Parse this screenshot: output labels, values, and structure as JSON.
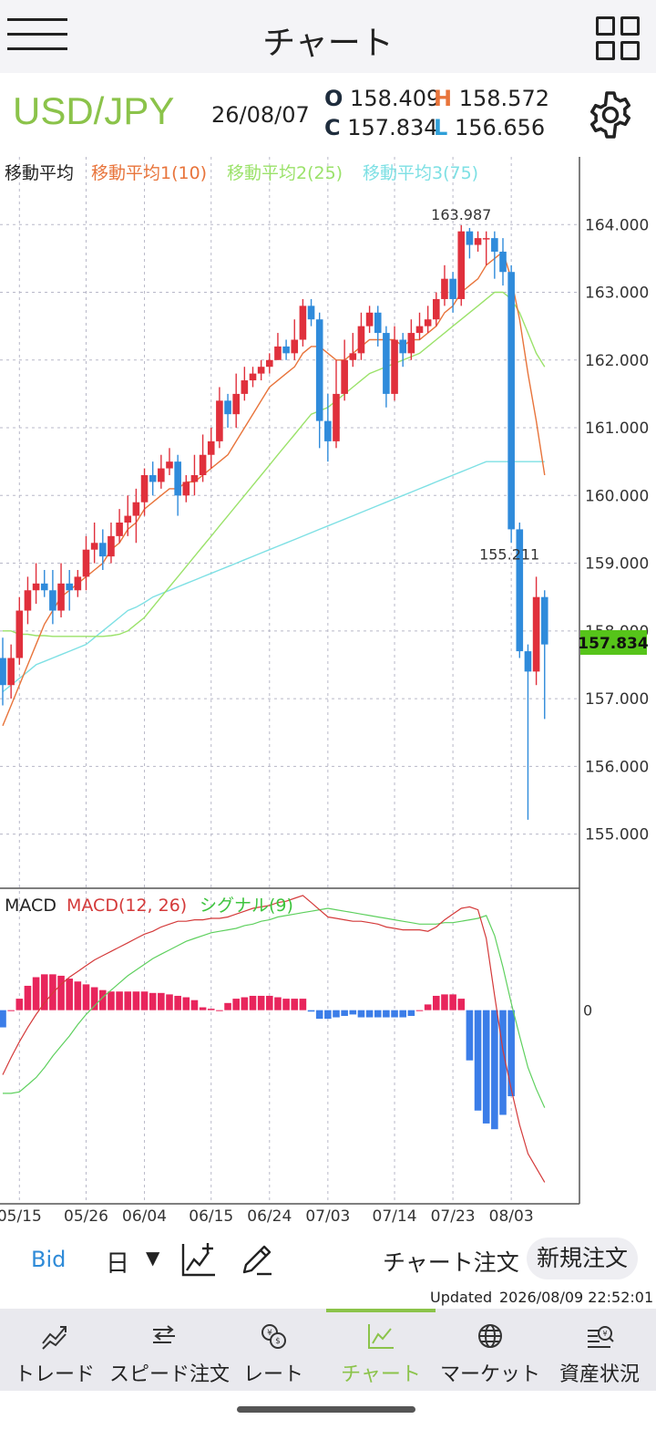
{
  "header": {
    "title": "チャート"
  },
  "quote": {
    "pair": "USD/JPY",
    "date": "26/08/07",
    "open_label": "O",
    "open": "158.409",
    "high_label": "H",
    "high": "158.572",
    "close_label": "C",
    "close": "157.834",
    "low_label": "L",
    "low": "156.656"
  },
  "legend": {
    "main": "移動平均",
    "ma1": "移動平均1(10)",
    "ma2": "移動平均2(25)",
    "ma3": "移動平均3(75)",
    "macd_main": "MACD",
    "macd": "MACD(12, 26)",
    "signal": "シグナル(9)"
  },
  "colors": {
    "up": "#e0303c",
    "down": "#2f8bdb",
    "ma1": "#e8743b",
    "ma2": "#9be26a",
    "ma3": "#7ee0e4",
    "macd_line": "#d43a3a",
    "signal_line": "#5ed05e",
    "hist_pos": "#e8255c",
    "hist_neg": "#3b7de8",
    "accent": "#8bc34a"
  },
  "chart_data": {
    "type": "candlestick",
    "ylim": [
      154.2,
      165.0
    ],
    "yticks": [
      "164.000",
      "163.000",
      "162.000",
      "161.000",
      "160.000",
      "159.000",
      "158.000",
      "157.000",
      "156.000",
      "155.000"
    ],
    "ytick_values": [
      164,
      163,
      162,
      161,
      160,
      159,
      158,
      157,
      156,
      155
    ],
    "xticks": [
      "05/15",
      "05/26",
      "06/04",
      "06/15",
      "06/24",
      "07/03",
      "07/14",
      "07/23",
      "08/03"
    ],
    "xtick_index": [
      2,
      10,
      17,
      25,
      32,
      39,
      47,
      54,
      61
    ],
    "last_price": "157.834",
    "max_label": "163.987",
    "max_index": 55,
    "min_label": "155.211",
    "min_index": 61,
    "candles": [
      [
        157.6,
        157.2,
        157.9,
        156.9
      ],
      [
        157.2,
        157.6,
        157.8,
        157.0
      ],
      [
        157.6,
        158.3,
        158.5,
        157.5
      ],
      [
        158.3,
        158.6,
        158.8,
        158.1
      ],
      [
        158.6,
        158.7,
        159.0,
        158.4
      ],
      [
        158.7,
        158.6,
        158.9,
        158.5
      ],
      [
        158.6,
        158.3,
        158.9,
        158.1
      ],
      [
        158.3,
        158.7,
        159.0,
        158.2
      ],
      [
        158.7,
        158.6,
        158.9,
        158.3
      ],
      [
        158.6,
        158.8,
        158.9,
        158.5
      ],
      [
        158.8,
        159.2,
        159.4,
        158.6
      ],
      [
        159.2,
        159.3,
        159.6,
        159.0
      ],
      [
        159.3,
        159.1,
        159.5,
        158.9
      ],
      [
        159.1,
        159.4,
        159.6,
        159.0
      ],
      [
        159.4,
        159.6,
        159.8,
        159.3
      ],
      [
        159.6,
        159.7,
        160.0,
        159.4
      ],
      [
        159.7,
        159.9,
        160.1,
        159.3
      ],
      [
        159.9,
        160.3,
        160.4,
        159.7
      ],
      [
        160.3,
        160.2,
        160.5,
        160.0
      ],
      [
        160.2,
        160.4,
        160.6,
        160.1
      ],
      [
        160.4,
        160.5,
        160.7,
        160.3
      ],
      [
        160.5,
        160.0,
        160.6,
        159.7
      ],
      [
        160.0,
        160.2,
        160.3,
        159.9
      ],
      [
        160.2,
        160.3,
        160.6,
        160.0
      ],
      [
        160.3,
        160.6,
        160.9,
        160.2
      ],
      [
        160.6,
        160.8,
        161.0,
        160.4
      ],
      [
        160.8,
        161.4,
        161.6,
        160.7
      ],
      [
        161.4,
        161.2,
        161.5,
        161.0
      ],
      [
        161.2,
        161.5,
        161.8,
        161.0
      ],
      [
        161.5,
        161.7,
        161.9,
        161.4
      ],
      [
        161.7,
        161.8,
        161.9,
        161.6
      ],
      [
        161.8,
        161.9,
        162.0,
        161.7
      ],
      [
        161.9,
        162.0,
        162.1,
        161.8
      ],
      [
        162.0,
        162.2,
        162.4,
        162.0
      ],
      [
        162.2,
        162.1,
        162.3,
        162.0
      ],
      [
        162.1,
        162.3,
        162.6,
        162.0
      ],
      [
        162.3,
        162.8,
        162.9,
        162.2
      ],
      [
        162.8,
        162.6,
        162.9,
        162.5
      ],
      [
        162.6,
        161.1,
        162.7,
        160.7
      ],
      [
        161.1,
        160.8,
        161.5,
        160.5
      ],
      [
        160.8,
        161.5,
        162.0,
        160.7
      ],
      [
        161.5,
        162.0,
        162.3,
        161.4
      ],
      [
        162.0,
        162.1,
        162.4,
        161.9
      ],
      [
        162.1,
        162.5,
        162.7,
        162.0
      ],
      [
        162.5,
        162.7,
        162.8,
        162.4
      ],
      [
        162.7,
        162.4,
        162.8,
        162.2
      ],
      [
        162.4,
        161.5,
        162.5,
        161.3
      ],
      [
        161.5,
        162.3,
        162.5,
        161.4
      ],
      [
        162.3,
        162.1,
        162.4,
        161.9
      ],
      [
        162.1,
        162.4,
        162.6,
        162.0
      ],
      [
        162.4,
        162.5,
        162.7,
        162.3
      ],
      [
        162.5,
        162.6,
        162.8,
        162.4
      ],
      [
        162.6,
        162.9,
        163.0,
        162.5
      ],
      [
        162.9,
        163.2,
        163.4,
        162.8
      ],
      [
        163.2,
        162.9,
        163.3,
        162.7
      ],
      [
        162.9,
        163.9,
        163.99,
        162.8
      ],
      [
        163.9,
        163.7,
        163.95,
        163.5
      ],
      [
        163.7,
        163.8,
        163.9,
        163.6
      ],
      [
        163.8,
        163.8,
        163.9,
        163.4
      ],
      [
        163.8,
        163.6,
        163.9,
        163.2
      ],
      [
        163.6,
        163.3,
        163.8,
        163.1
      ],
      [
        163.3,
        159.5,
        163.4,
        159.3
      ],
      [
        159.5,
        157.7,
        159.6,
        157.6
      ],
      [
        157.7,
        157.4,
        157.8,
        155.211
      ],
      [
        157.4,
        158.5,
        158.8,
        157.2
      ],
      [
        158.5,
        157.8,
        158.6,
        156.7
      ]
    ],
    "ma1": [
      156.6,
      156.9,
      157.2,
      157.5,
      157.8,
      158.1,
      158.3,
      158.5,
      158.6,
      158.7,
      158.8,
      158.9,
      159.0,
      159.2,
      159.3,
      159.5,
      159.6,
      159.8,
      159.9,
      160.0,
      160.1,
      160.1,
      160.2,
      160.2,
      160.3,
      160.4,
      160.5,
      160.6,
      160.8,
      161.0,
      161.2,
      161.4,
      161.6,
      161.7,
      161.8,
      161.9,
      162.1,
      162.2,
      162.2,
      162.1,
      162.0,
      162.0,
      162.1,
      162.2,
      162.3,
      162.3,
      162.3,
      162.3,
      162.2,
      162.3,
      162.3,
      162.4,
      162.5,
      162.7,
      162.8,
      163.0,
      163.1,
      163.2,
      163.4,
      163.5,
      163.6,
      163.2,
      162.6,
      161.8,
      161.1,
      160.3
    ],
    "ma2": [
      158.0,
      158.0,
      157.95,
      157.95,
      157.93,
      157.93,
      157.92,
      157.92,
      157.92,
      157.92,
      157.92,
      157.92,
      157.92,
      157.93,
      157.95,
      158.0,
      158.1,
      158.2,
      158.35,
      158.5,
      158.65,
      158.8,
      158.95,
      159.1,
      159.25,
      159.4,
      159.55,
      159.7,
      159.85,
      160.0,
      160.15,
      160.3,
      160.45,
      160.6,
      160.75,
      160.9,
      161.05,
      161.2,
      161.25,
      161.3,
      161.4,
      161.5,
      161.6,
      161.7,
      161.8,
      161.85,
      161.9,
      161.95,
      162.0,
      162.05,
      162.1,
      162.2,
      162.3,
      162.4,
      162.5,
      162.6,
      162.7,
      162.8,
      162.9,
      163.0,
      163.0,
      162.9,
      162.7,
      162.4,
      162.1,
      161.9
    ],
    "ma3": [
      157.1,
      157.2,
      157.3,
      157.4,
      157.5,
      157.55,
      157.6,
      157.65,
      157.7,
      157.75,
      157.8,
      157.9,
      158.0,
      158.1,
      158.2,
      158.3,
      158.35,
      158.42,
      158.5,
      158.55,
      158.6,
      158.65,
      158.7,
      158.75,
      158.8,
      158.85,
      158.9,
      158.95,
      159.0,
      159.05,
      159.1,
      159.15,
      159.2,
      159.25,
      159.3,
      159.35,
      159.4,
      159.45,
      159.5,
      159.55,
      159.6,
      159.65,
      159.7,
      159.75,
      159.8,
      159.85,
      159.9,
      159.95,
      160.0,
      160.05,
      160.1,
      160.15,
      160.2,
      160.25,
      160.3,
      160.35,
      160.4,
      160.45,
      160.5,
      160.5,
      160.5,
      160.5,
      160.5,
      160.5,
      160.5,
      160.5
    ],
    "macd_ylim": [
      -1.35,
      0.85
    ],
    "macd_zero_label": "0",
    "macd_line": [
      -0.45,
      -0.33,
      -0.22,
      -0.12,
      -0.03,
      0.05,
      0.12,
      0.18,
      0.23,
      0.27,
      0.31,
      0.35,
      0.38,
      0.41,
      0.44,
      0.47,
      0.5,
      0.53,
      0.55,
      0.58,
      0.6,
      0.62,
      0.62,
      0.63,
      0.63,
      0.64,
      0.64,
      0.65,
      0.67,
      0.69,
      0.71,
      0.72,
      0.73,
      0.75,
      0.76,
      0.78,
      0.8,
      0.75,
      0.7,
      0.65,
      0.64,
      0.63,
      0.62,
      0.62,
      0.61,
      0.6,
      0.58,
      0.57,
      0.56,
      0.56,
      0.56,
      0.55,
      0.58,
      0.63,
      0.67,
      0.71,
      0.72,
      0.7,
      0.5,
      0.1,
      -0.28,
      -0.55,
      -0.8,
      -1.0,
      -1.1,
      -1.2
    ],
    "signal_line": [
      -0.58,
      -0.58,
      -0.57,
      -0.52,
      -0.47,
      -0.4,
      -0.32,
      -0.25,
      -0.18,
      -0.1,
      -0.03,
      0.03,
      0.09,
      0.14,
      0.19,
      0.24,
      0.28,
      0.32,
      0.36,
      0.39,
      0.42,
      0.45,
      0.48,
      0.5,
      0.52,
      0.54,
      0.55,
      0.56,
      0.57,
      0.59,
      0.6,
      0.62,
      0.63,
      0.65,
      0.66,
      0.67,
      0.68,
      0.69,
      0.7,
      0.71,
      0.7,
      0.69,
      0.68,
      0.67,
      0.66,
      0.65,
      0.64,
      0.63,
      0.62,
      0.61,
      0.6,
      0.6,
      0.6,
      0.61,
      0.61,
      0.62,
      0.63,
      0.64,
      0.66,
      0.52,
      0.3,
      0.05,
      -0.18,
      -0.4,
      -0.55,
      -0.68
    ],
    "histogram": [
      -0.12,
      0.0,
      0.08,
      0.17,
      0.23,
      0.25,
      0.25,
      0.24,
      0.22,
      0.2,
      0.18,
      0.16,
      0.14,
      0.13,
      0.13,
      0.13,
      0.13,
      0.13,
      0.12,
      0.12,
      0.11,
      0.1,
      0.09,
      0.07,
      0.02,
      0.01,
      0.0,
      0.05,
      0.08,
      0.09,
      0.1,
      0.1,
      0.1,
      0.09,
      0.08,
      0.08,
      0.08,
      -0.01,
      -0.06,
      -0.06,
      -0.05,
      -0.04,
      -0.03,
      -0.05,
      -0.05,
      -0.05,
      -0.05,
      -0.05,
      -0.05,
      -0.04,
      0.0,
      0.04,
      0.1,
      0.11,
      0.11,
      0.08,
      -0.35,
      -0.7,
      -0.79,
      -0.83,
      -0.73,
      -0.6
    ]
  },
  "toolbar": {
    "bid": "Bid",
    "period": "日",
    "period_arrow": "▼",
    "chart_order": "チャート注文",
    "new_order": "新規注文"
  },
  "status": {
    "updated_label": "Updated",
    "updated_value": "2026/08/09  22:52:01"
  },
  "tabs": [
    {
      "label": "トレード",
      "icon": "trade-icon"
    },
    {
      "label": "スピード注文",
      "icon": "speed-order-icon"
    },
    {
      "label": "レート",
      "icon": "rate-icon"
    },
    {
      "label": "チャート",
      "icon": "chart-icon"
    },
    {
      "label": "マーケット",
      "icon": "market-icon"
    },
    {
      "label": "資産状況",
      "icon": "assets-icon"
    }
  ]
}
